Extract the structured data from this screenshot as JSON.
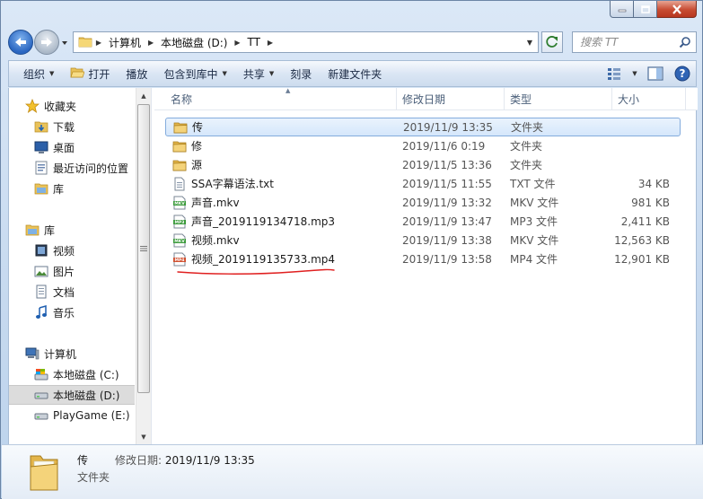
{
  "window": {
    "caption_buttons": [
      "minimize-icon",
      "maximize-icon",
      "close-icon"
    ]
  },
  "address": {
    "crumbs": [
      "计算机",
      "本地磁盘 (D:)",
      "TT"
    ]
  },
  "search": {
    "placeholder": "搜索 TT"
  },
  "toolbar": {
    "organize": "组织",
    "open": "打开",
    "play": "播放",
    "include_library": "包含到库中",
    "share": "共享",
    "burn": "刻录",
    "new_folder": "新建文件夹"
  },
  "nav": {
    "favorites": "收藏夹",
    "downloads": "下载",
    "desktop": "桌面",
    "recent": "最近访问的位置",
    "libraries_fav": "库",
    "libraries": "库",
    "videos": "视频",
    "pictures": "图片",
    "documents": "文档",
    "music": "音乐",
    "computer": "计算机",
    "drive_c": "本地磁盘 (C:)",
    "drive_d": "本地磁盘 (D:)",
    "drive_e": "PlayGame (E:)"
  },
  "columns": {
    "name": "名称",
    "date": "修改日期",
    "type": "类型",
    "size": "大小"
  },
  "files": [
    {
      "name": "传",
      "date": "2019/11/9 13:35",
      "type": "文件夹",
      "size": "",
      "icon": "folder-icon",
      "selected": true
    },
    {
      "name": "修",
      "date": "2019/11/6 0:19",
      "type": "文件夹",
      "size": "",
      "icon": "folder-icon"
    },
    {
      "name": "源",
      "date": "2019/11/5 13:36",
      "type": "文件夹",
      "size": "",
      "icon": "folder-icon"
    },
    {
      "name": "SSA字幕语法.txt",
      "date": "2019/11/5 11:55",
      "type": "TXT 文件",
      "size": "34 KB",
      "icon": "text-file-icon"
    },
    {
      "name": "声音.mkv",
      "date": "2019/11/9 13:32",
      "type": "MKV 文件",
      "size": "981 KB",
      "icon": "mkv-file-icon"
    },
    {
      "name": "声音_20191191347​18.mp3",
      "date": "2019/11/9 13:47",
      "type": "MP3 文件",
      "size": "2,411 KB",
      "icon": "mp3-file-icon"
    },
    {
      "name": "视频.mkv",
      "date": "2019/11/9 13:38",
      "type": "MKV 文件",
      "size": "12,563 KB",
      "icon": "mkv-file-icon"
    },
    {
      "name": "视频_2019119135733.mp4",
      "date": "2019/11/9 13:58",
      "type": "MP4 文件",
      "size": "12,901 KB",
      "icon": "mp4-file-icon"
    }
  ],
  "details": {
    "name": "传",
    "type": "文件夹",
    "modified_label": "修改日期:",
    "modified_value": "2019/11/9 13:35"
  },
  "colors": {
    "selection_border": "#84acdd",
    "annotation": "#e02020",
    "mkv_green": "#3a9a3a",
    "mp4_red": "#d05030"
  }
}
